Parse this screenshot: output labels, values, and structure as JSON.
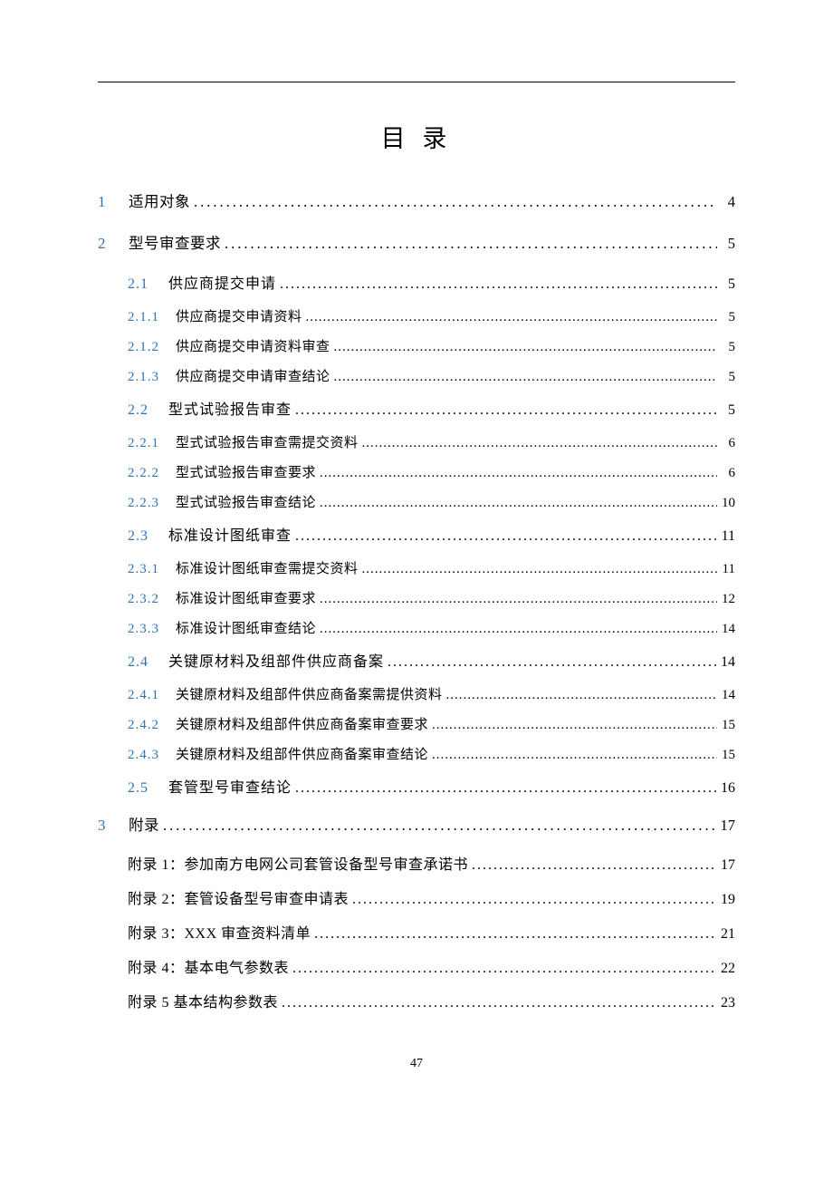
{
  "title": "目 录",
  "page_number": "47",
  "toc": [
    {
      "lvl": 1,
      "num": "1",
      "txt": "适用对象",
      "pg": "4"
    },
    {
      "lvl": 1,
      "num": "2",
      "txt": "型号审查要求",
      "pg": "5"
    },
    {
      "lvl": 2,
      "num": "2.1",
      "txt": "供应商提交申请",
      "pg": "5"
    },
    {
      "lvl": 3,
      "num": "2.1.1",
      "txt": "供应商提交申请资料",
      "pg": "5"
    },
    {
      "lvl": 3,
      "num": "2.1.2",
      "txt": "供应商提交申请资料审查",
      "pg": "5"
    },
    {
      "lvl": 3,
      "num": "2.1.3",
      "txt": "供应商提交申请审查结论",
      "pg": "5"
    },
    {
      "lvl": 2,
      "num": "2.2",
      "txt": "型式试验报告审查",
      "pg": "5"
    },
    {
      "lvl": 3,
      "num": "2.2.1",
      "txt": "型式试验报告审查需提交资料",
      "pg": "6"
    },
    {
      "lvl": 3,
      "num": "2.2.2",
      "txt": "型式试验报告审查要求",
      "pg": "6"
    },
    {
      "lvl": 3,
      "num": "2.2.3",
      "txt": "型式试验报告审查结论",
      "pg": "10"
    },
    {
      "lvl": 2,
      "num": "2.3",
      "txt": "标准设计图纸审查",
      "pg": "11"
    },
    {
      "lvl": 3,
      "num": "2.3.1",
      "txt": "标准设计图纸审查需提交资料",
      "pg": "11"
    },
    {
      "lvl": 3,
      "num": "2.3.2",
      "txt": "标准设计图纸审查要求",
      "pg": "12"
    },
    {
      "lvl": 3,
      "num": "2.3.3",
      "txt": "标准设计图纸审查结论",
      "pg": "14"
    },
    {
      "lvl": 2,
      "num": "2.4",
      "txt": "关键原材料及组部件供应商备案",
      "pg": "14"
    },
    {
      "lvl": 3,
      "num": "2.4.1",
      "txt": "关键原材料及组部件供应商备案需提供资料",
      "pg": "14"
    },
    {
      "lvl": 3,
      "num": "2.4.2",
      "txt": "关键原材料及组部件供应商备案审查要求",
      "pg": "15"
    },
    {
      "lvl": 3,
      "num": "2.4.3",
      "txt": "关键原材料及组部件供应商备案审查结论",
      "pg": "15"
    },
    {
      "lvl": 2,
      "num": "2.5",
      "txt": "套管型号审查结论",
      "pg": "16"
    },
    {
      "lvl": 1,
      "num": "3",
      "txt": "附录",
      "pg": "17"
    },
    {
      "lvl": "A",
      "num": "",
      "txt": "附录 1：参加南方电网公司套管设备型号审查承诺书",
      "pg": "17"
    },
    {
      "lvl": "A",
      "num": "",
      "txt": "附录 2：套管设备型号审查申请表",
      "pg": "19"
    },
    {
      "lvl": "A",
      "num": "",
      "txt": "附录 3：XXX 审查资料清单",
      "pg": "21"
    },
    {
      "lvl": "A",
      "num": "",
      "txt": "附录 4：基本电气参数表",
      "pg": "22"
    },
    {
      "lvl": "A",
      "num": "",
      "txt": "附录 5 基本结构参数表",
      "pg": "23"
    }
  ]
}
